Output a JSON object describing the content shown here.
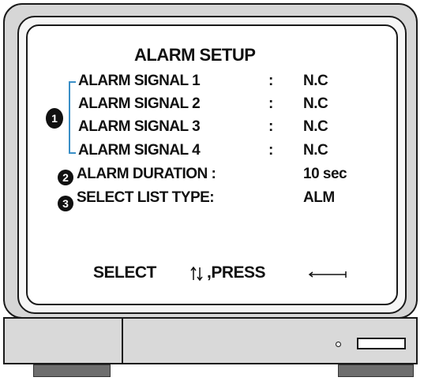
{
  "title": "ALARM SETUP",
  "rows": [
    {
      "label": "ALARM SIGNAL 1",
      "colon": ":",
      "value": "N.C"
    },
    {
      "label": "ALARM SIGNAL 2",
      "colon": ":",
      "value": "N.C"
    },
    {
      "label": "ALARM SIGNAL 3",
      "colon": ":",
      "value": "N.C"
    },
    {
      "label": "ALARM SIGNAL 4",
      "colon": ":",
      "value": "N.C"
    }
  ],
  "duration": {
    "label": "ALARM DURATION :",
    "value": "10 sec"
  },
  "list_type": {
    "label": "SELECT LIST TYPE:",
    "value": "ALM"
  },
  "markers": [
    "1",
    "2",
    "3"
  ],
  "footer": {
    "select": "SELECT",
    "press": ",PRESS",
    "select_icon": "up-down-arrows-icon",
    "press_icon": "enter-key-icon"
  }
}
